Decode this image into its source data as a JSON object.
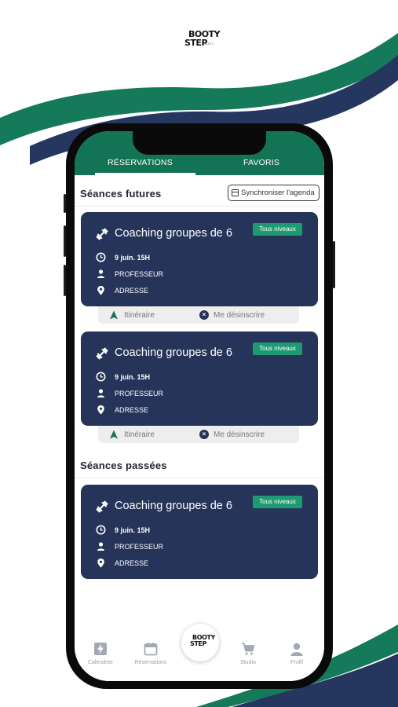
{
  "brand": {
    "line1": "BOOTY",
    "line2": "STEP",
    "line3": "B.STL"
  },
  "colors": {
    "green": "#137355",
    "navy": "#263459",
    "badge": "#1e9a72",
    "wave_green": "#157a5a",
    "wave_navy": "#25365f"
  },
  "tabs": [
    {
      "label": "RÉSERVATIONS",
      "active": true
    },
    {
      "label": "FAVORIS",
      "active": false
    }
  ],
  "future": {
    "title": "Séances futures",
    "sync_label": "Synchroniser l'agenda",
    "cards": [
      {
        "title": "Coaching groupes de 6",
        "badge": "Tous niveaux",
        "date": "9 juin. 15H",
        "teacher": "PROFESSEUR",
        "address": "ADRESSE",
        "route_label": "Itinéraire",
        "unsubscribe_label": "Me désinscrire"
      },
      {
        "title": "Coaching groupes de 6",
        "badge": "Tous niveaux",
        "date": "9 juin. 15H",
        "teacher": "PROFESSEUR",
        "address": "ADRESSE",
        "route_label": "Itinéraire",
        "unsubscribe_label": "Me désinscrire"
      }
    ]
  },
  "past": {
    "title": "Séances passées",
    "cards": [
      {
        "title": "Coaching groupes de 6",
        "badge": "Tous niveaux",
        "date": "9 juin. 15H",
        "teacher": "PROFESSEUR",
        "address": "ADRESSE"
      }
    ]
  },
  "bottom_nav": {
    "items": [
      {
        "label": "Calendrier",
        "icon": "bolt-icon"
      },
      {
        "label": "Réservations",
        "icon": "calendar-icon"
      },
      {
        "label": "Studio",
        "icon": "cart-icon"
      },
      {
        "label": "Profil",
        "icon": "user-icon"
      }
    ],
    "center": {
      "line1": "BOOTY",
      "line2": "STEP"
    }
  }
}
